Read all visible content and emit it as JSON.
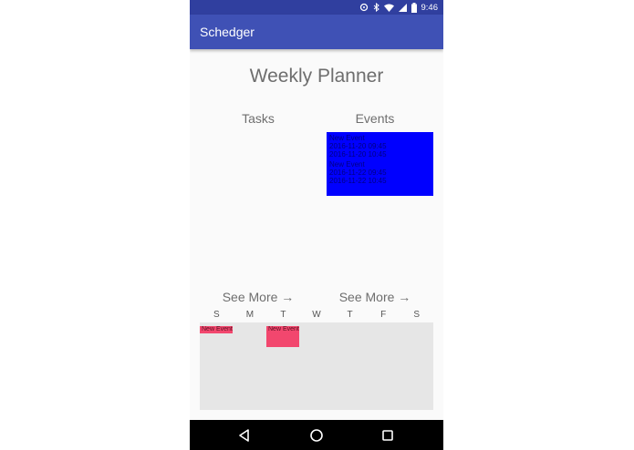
{
  "status_bar": {
    "time": "9:46",
    "icons": [
      "sync-icon",
      "bluetooth-icon",
      "wifi-icon",
      "cell-signal-icon",
      "battery-icon"
    ]
  },
  "app_bar": {
    "title": "Schedger"
  },
  "main": {
    "title": "Weekly Planner",
    "tasks_heading": "Tasks",
    "events_heading": "Events",
    "events": [
      {
        "title": "New Event",
        "start": "2016-11-20 09:45",
        "end": "2016-11-20 10:45"
      },
      {
        "title": "New Event",
        "start": "2016-11-22 09:45",
        "end": "2016-11-22 10:45"
      }
    ],
    "see_more_tasks": "See More →",
    "see_more_events": "See More →"
  },
  "calendar": {
    "days": [
      "S",
      "M",
      "T",
      "W",
      "T",
      "F",
      "S"
    ],
    "events": [
      {
        "label": "New Event",
        "day": "S"
      },
      {
        "label": "New Event",
        "day": "T"
      }
    ]
  },
  "nav_bar": {
    "buttons": [
      "back-icon",
      "home-icon",
      "recents-icon"
    ]
  },
  "colors": {
    "status_bar": "#303f9f",
    "app_bar": "#3f51b5",
    "events_box": "#0000ff",
    "calendar_event": "#f2476e",
    "calendar_bg": "#e6e6e6"
  }
}
